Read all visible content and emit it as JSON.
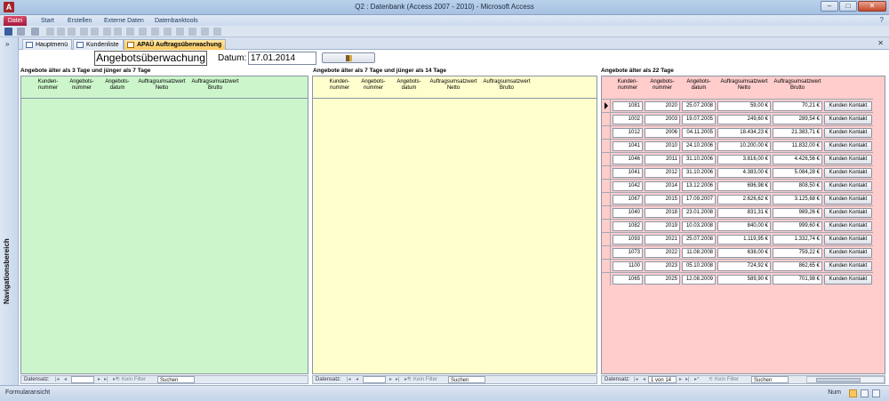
{
  "window": {
    "app_icon_letter": "A",
    "title": "Q2 : Datenbank (Access 2007 - 2010)  -  Microsoft Access",
    "minimize": "–",
    "maximize": "□",
    "close": "✕"
  },
  "ribbon": {
    "tabs": [
      "Datei",
      "Start",
      "Erstellen",
      "Externe Daten",
      "Datenbanktools"
    ],
    "help": "?"
  },
  "nav_pane": {
    "toggle": "»",
    "label": "Navigationsbereich"
  },
  "doc_tabs": [
    {
      "label": "Hauptmenü"
    },
    {
      "label": "Kundenliste"
    },
    {
      "label": "APAÜ Auftragsüberwachung"
    }
  ],
  "doc_close": "✕",
  "form": {
    "title": "Angebotsüberwachung",
    "datum_label": "Datum:",
    "datum_value": "17.01.2014"
  },
  "panels": {
    "green": {
      "title": "Angebote älter als 3 Tage und jünger als 7 Tage",
      "columns": [
        "Kunden-\nnummer",
        "Angebots-\nnummer",
        "Angebots-\ndatum",
        "Auftragsumsatzwert\nNetto",
        "Auftragsumsatzwert\nBrutto"
      ],
      "nav": {
        "label": "Datensatz:",
        "first": "|◂",
        "prev": "◂",
        "next": "▸",
        "last": "▸|",
        "new": "▸*",
        "filter": "Kein Filter",
        "search": "Suchen"
      }
    },
    "yellow": {
      "title": "Angebote älter als 7 Tage und jünger als 14 Tage",
      "columns": [
        "Kunden-\nnummer",
        "Angebots-\nnummer",
        "Angebots-\ndatum",
        "Auftragsumsatzwert\nNetto",
        "Auftragsumsatzwert\nBrutto"
      ],
      "nav": {
        "label": "Datensatz:",
        "first": "|◂",
        "prev": "◂",
        "next": "▸",
        "last": "▸|",
        "new": "▸*",
        "filter": "Kein Filter",
        "search": "Suchen"
      }
    },
    "red": {
      "title": "Angebote älter als 22 Tage",
      "columns": [
        "Kunden-\nnummer",
        "Angebots-\nnummer",
        "Angebots-\ndatum",
        "Auftragsumsatzwert\nNetto",
        "Auftragsumsatzwert\nBrutto"
      ],
      "button_label": "Kunden Kontakt",
      "rows": [
        [
          "1081",
          "2020",
          "25.07.2008",
          "59,00 €",
          "70,21 €"
        ],
        [
          "1002",
          "2003",
          "19.07.2005",
          "249,60 €",
          "289,54 €"
        ],
        [
          "1012",
          "2006",
          "04.11.2005",
          "18.434,23 €",
          "21.383,71 €"
        ],
        [
          "1041",
          "2010",
          "24.10.2006",
          "10.200,00 €",
          "11.832,00 €"
        ],
        [
          "1046",
          "2011",
          "31.10.2006",
          "3.816,00 €",
          "4.426,56 €"
        ],
        [
          "1041",
          "2012",
          "31.10.2006",
          "4.383,00 €",
          "5.084,28 €"
        ],
        [
          "1042",
          "2014",
          "13.12.2006",
          "696,98 €",
          "808,50 €"
        ],
        [
          "1067",
          "2015",
          "17.09.2007",
          "2.626,62 €",
          "3.125,68 €"
        ],
        [
          "1040",
          "2018",
          "23.01.2008",
          "831,31 €",
          "989,26 €"
        ],
        [
          "1082",
          "2019",
          "10.03.2008",
          "840,00 €",
          "999,60 €"
        ],
        [
          "1093",
          "2021",
          "25.07.2008",
          "1.119,95 €",
          "1.332,74 €"
        ],
        [
          "1073",
          "2022",
          "11.08.2008",
          "638,00 €",
          "759,22 €"
        ],
        [
          "1100",
          "2023",
          "05.10.2008",
          "724,92 €",
          "862,65 €"
        ],
        [
          "1065",
          "2025",
          "12.08.2009",
          "589,90 €",
          "701,98 €"
        ]
      ],
      "nav": {
        "label": "Datensatz:",
        "first": "|◂",
        "prev": "◂",
        "position": "1 von 14",
        "next": "▸",
        "last": "▸|",
        "new": "▸*",
        "filter": "Kein Filter",
        "search": "Suchen"
      }
    }
  },
  "status": {
    "left": "Formularansicht",
    "num": "Num"
  },
  "colors": {
    "green_panel": "#ccf5cb",
    "yellow_panel": "#feffcd",
    "red_panel": "#fecdcc",
    "file_tab": "#a3193d",
    "active_tab": "#fbc75a"
  }
}
